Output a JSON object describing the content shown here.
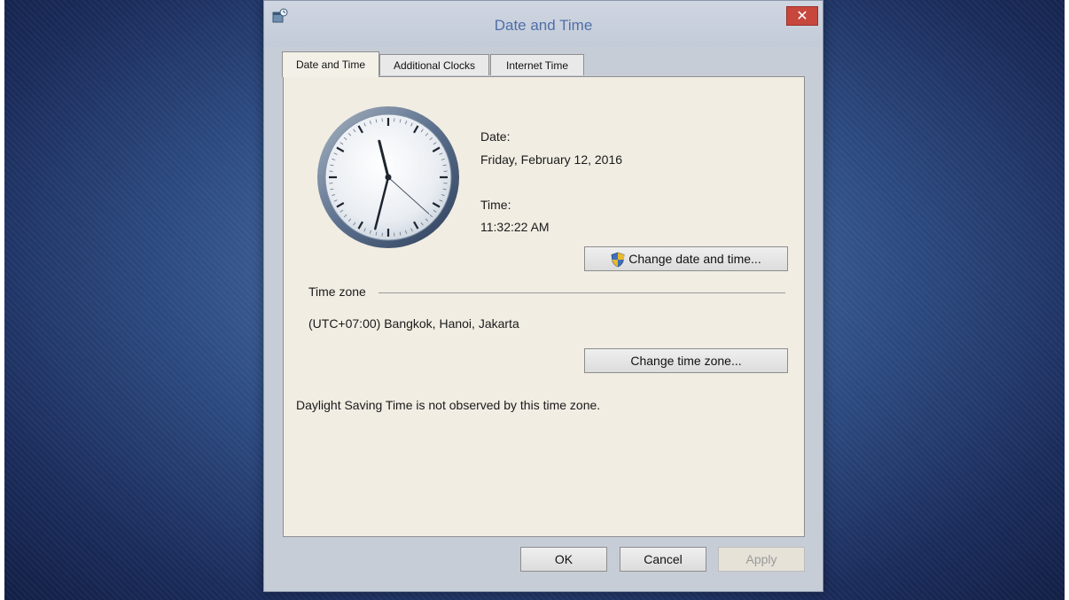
{
  "window": {
    "title": "Date and Time",
    "close_symbol": "✕"
  },
  "tabs": [
    {
      "label": "Date and Time",
      "active": true
    },
    {
      "label": "Additional Clocks",
      "active": false
    },
    {
      "label": "Internet Time",
      "active": false
    }
  ],
  "date_section": {
    "date_label": "Date:",
    "date_value": "Friday, February 12, 2016",
    "time_label": "Time:",
    "time_value": "11:32:22 AM",
    "change_button": "Change date and time..."
  },
  "timezone_section": {
    "heading": "Time zone",
    "value": "(UTC+07:00) Bangkok, Hanoi, Jakarta",
    "change_button": "Change time zone...",
    "dst_note": "Daylight Saving Time is not observed by this time zone."
  },
  "footer": {
    "ok": "OK",
    "cancel": "Cancel",
    "apply": "Apply"
  },
  "icons": {
    "app": "date-time-icon",
    "clock": "analog-clock-icon",
    "shield": "uac-shield-icon"
  },
  "clock_time": {
    "hour": 11,
    "minute": 32,
    "second": 22
  }
}
